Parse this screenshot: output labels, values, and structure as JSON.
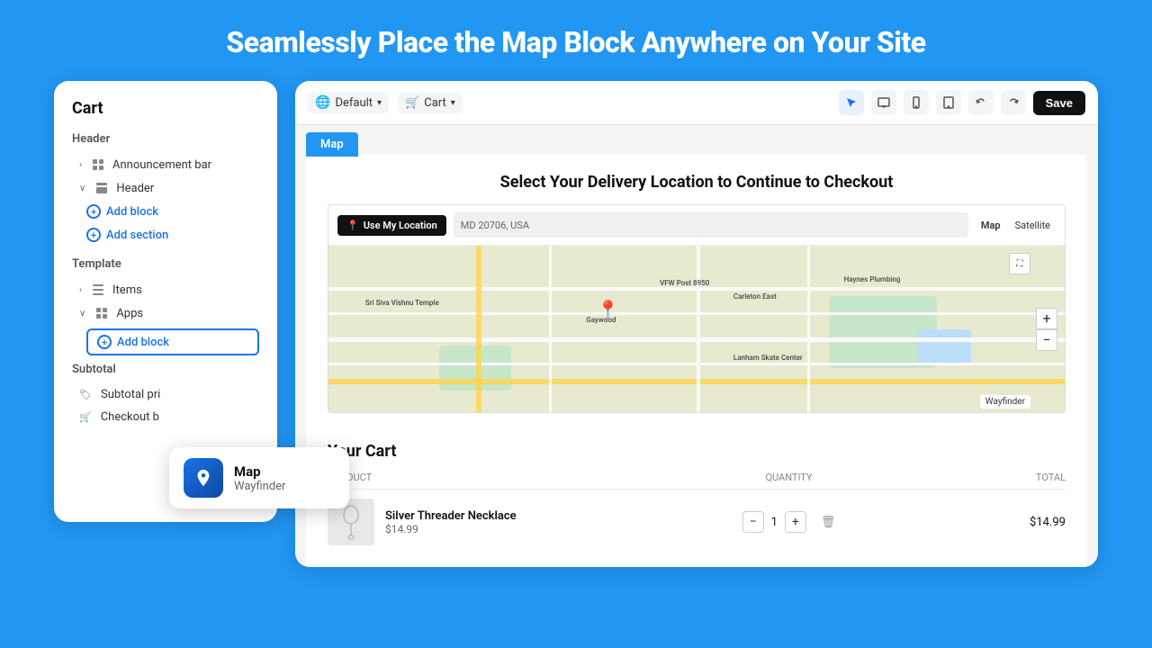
{
  "page": {
    "title": "Seamlessly Place the Map Block Anywhere on Your Site",
    "background_color": "#2196F3"
  },
  "toolbar": {
    "default_label": "Default",
    "cart_label": "Cart",
    "save_label": "Save",
    "icons": [
      "select",
      "desktop",
      "mobile",
      "tablet",
      "undo",
      "redo"
    ]
  },
  "sidebar": {
    "title": "Cart",
    "header_label": "Header",
    "announcement_bar_label": "Announcement bar",
    "header_item_label": "Header",
    "add_block_label": "Add block",
    "add_section_label": "Add section",
    "template_label": "Template",
    "items_label": "Items",
    "apps_label": "Apps",
    "subtotal_label": "Subtotal",
    "subtotal_pri_label": "Subtotal pri",
    "checkout_b_label": "Checkout b"
  },
  "tooltip": {
    "title": "Map",
    "subtitle": "Wayfinder"
  },
  "store": {
    "delivery_title": "Select Your Delivery Location to Continue to Checkout",
    "use_location_label": "Use My Location",
    "address_value": "MD 20706, USA",
    "map_tab_label": "Map",
    "satellite_tab_label": "Satellite",
    "map_view_label": "Map",
    "your_cart_label": "Your Cart",
    "table_headers": {
      "product": "PRODUCT",
      "quantity": "QUANTITY",
      "total": "TOTAL"
    },
    "cart_item": {
      "name": "Silver Threader Necklace",
      "price": "$14.99",
      "quantity": 1,
      "total": "$14.99"
    }
  }
}
